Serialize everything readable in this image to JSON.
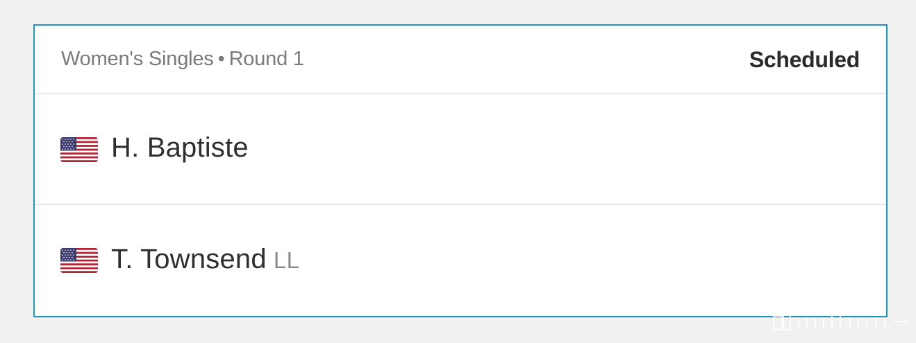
{
  "match": {
    "event": "Women's Singles",
    "separator": "•",
    "round": "Round 1",
    "status": "Scheduled"
  },
  "players": [
    {
      "name": "H. Baptiste",
      "country_flag": "us-flag-icon",
      "tag": ""
    },
    {
      "name": "T. Townsend",
      "country_flag": "us-flag-icon",
      "tag": "LL"
    }
  ],
  "colors": {
    "card_border": "#1a97bd",
    "background": "#f1f1f1",
    "text_primary": "#2f2f2f",
    "text_secondary": "#7a7a7a"
  }
}
